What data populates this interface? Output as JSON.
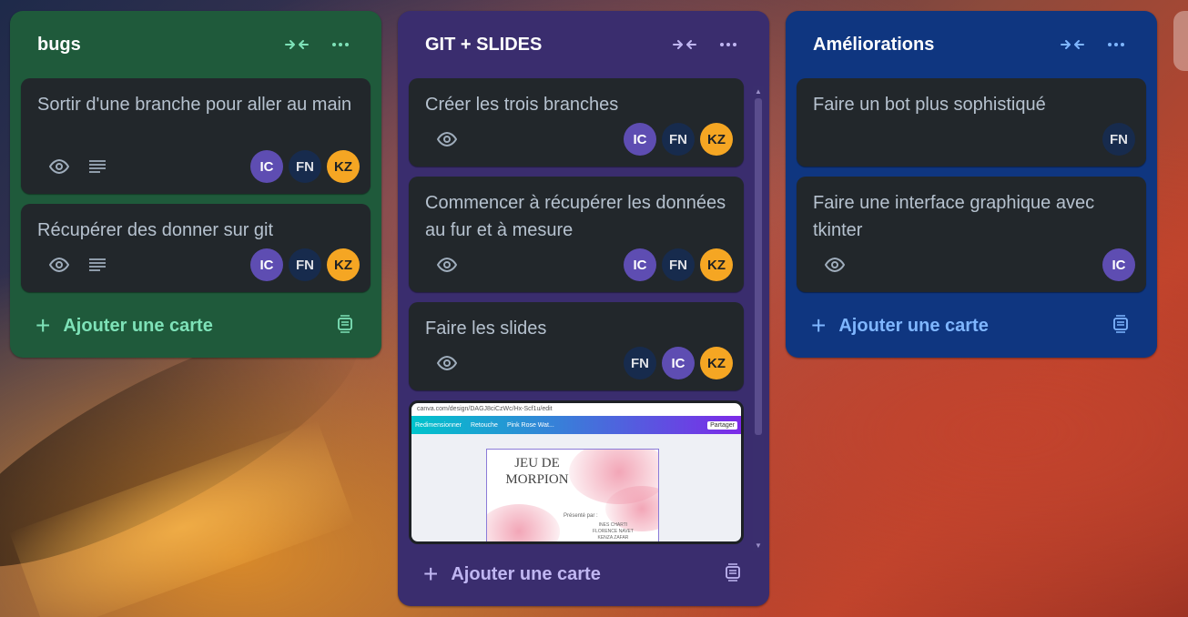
{
  "colors": {
    "bugs_bg": "#1f5a3b",
    "git_bg": "#3a2d6e",
    "amel_bg": "#0f3680",
    "bugs_accent": "#7ee2b8",
    "git_accent": "#c0b6f2",
    "amel_accent": "#7fb6ff",
    "card_bg": "#22272b",
    "avatar_ic": "#5e4db2",
    "avatar_fn": "#172b4d",
    "avatar_kz": "#f5a623"
  },
  "lists": [
    {
      "title": "bugs",
      "add_label": "Ajouter une carte",
      "cards": [
        {
          "title": "Sortir d'une branche pour aller au main",
          "icons": [
            "eye-icon",
            "description-icon"
          ],
          "members": [
            "IC",
            "FN",
            "KZ"
          ]
        },
        {
          "title": "Récupérer des donner sur git",
          "icons": [
            "eye-icon",
            "description-icon"
          ],
          "members": [
            "IC",
            "FN",
            "KZ"
          ]
        }
      ]
    },
    {
      "title": "GIT + SLIDES",
      "add_label": "Ajouter une carte",
      "cards": [
        {
          "title": "Créer les trois branches",
          "icons": [
            "eye-icon"
          ],
          "members": [
            "IC",
            "FN",
            "KZ"
          ]
        },
        {
          "title": "Commencer à récupérer les données au fur et à mesure",
          "icons": [
            "eye-icon"
          ],
          "members": [
            "IC",
            "FN",
            "KZ"
          ]
        },
        {
          "title": "Faire les slides",
          "icons": [
            "eye-icon"
          ],
          "members": [
            "FN",
            "IC",
            "KZ"
          ]
        }
      ],
      "cover": {
        "url": "canva.com/design/DAGJ8ciCzWc/Hx-Scf1u/edit",
        "toolbar": [
          "Redimensionner",
          "Retouche",
          "Pink Rose Wat...",
          "Partager"
        ],
        "slide_title": "JEU DE MORPION",
        "slide_sub": "Présenté par :",
        "slide_names": [
          "INES CHARTI",
          "FLORENCE NAVET",
          "KENZA ZAFAR"
        ]
      }
    },
    {
      "title": "Améliorations",
      "add_label": "Ajouter une carte",
      "cards": [
        {
          "title": "Faire un bot plus sophistiqué",
          "icons": [],
          "members": [
            "FN"
          ]
        },
        {
          "title": "Faire une interface graphique avec tkinter",
          "icons": [
            "eye-icon"
          ],
          "members": [
            "IC"
          ]
        }
      ]
    }
  ]
}
